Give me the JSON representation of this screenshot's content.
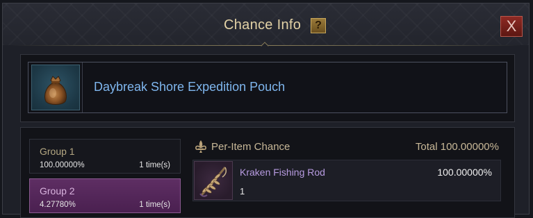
{
  "window": {
    "title": "Chance Info",
    "help_glyph": "?",
    "close_glyph": "X"
  },
  "item": {
    "name": "Daybreak Shore Expedition Pouch",
    "icon": "pouch-icon"
  },
  "groups": [
    {
      "name": "Group 1",
      "chance": "100.00000%",
      "times": "1 time(s)",
      "selected": false
    },
    {
      "name": "Group 2",
      "chance": "4.27780%",
      "times": "1 time(s)",
      "selected": true
    }
  ],
  "per_item": {
    "label": "Per-Item Chance",
    "total": "Total 100.00000%",
    "rows": [
      {
        "name": "Kraken Fishing Rod",
        "quantity": "1",
        "chance": "100.00000%",
        "icon": "fishing-rod-icon"
      }
    ]
  },
  "colors": {
    "item_name": "#7fb6ee",
    "reward_name": "#b79be0",
    "title": "#e3d2a6",
    "selected_group": "#5e2e63"
  }
}
